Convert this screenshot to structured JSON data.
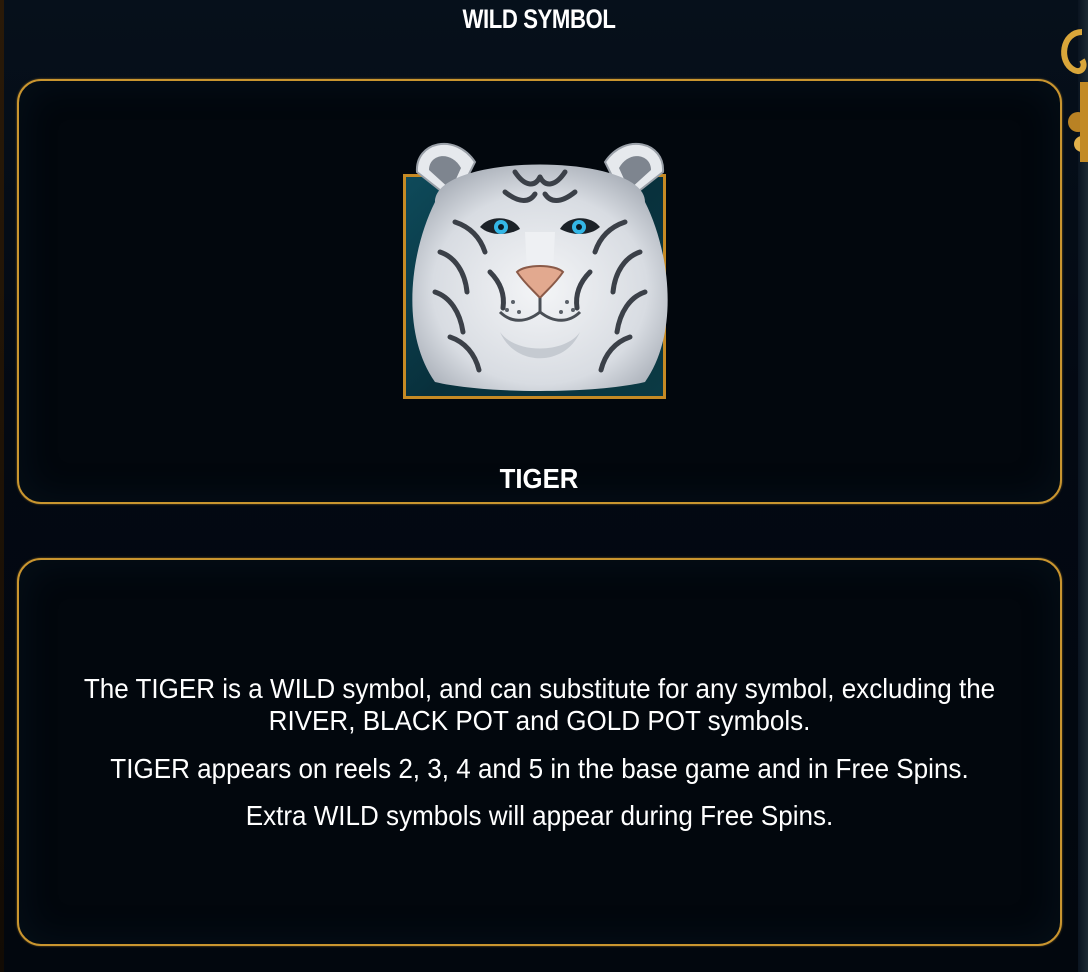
{
  "header": {
    "title": "WILD SYMBOL"
  },
  "symbol": {
    "name": "TIGER",
    "icon": "white-tiger-icon"
  },
  "description": {
    "lines": [
      "The TIGER is a WILD symbol, and can substitute for any symbol, excluding the RIVER, BLACK POT and GOLD POT symbols.",
      "TIGER appears on reels 2, 3, 4 and 5 in the base game and in Free Spins.",
      "Extra WILD symbols will appear during Free Spins."
    ]
  },
  "colors": {
    "border_gold": "#c9952f",
    "background": "#02070d",
    "text": "#ffffff",
    "tiger_eye": "#34b7e6"
  }
}
